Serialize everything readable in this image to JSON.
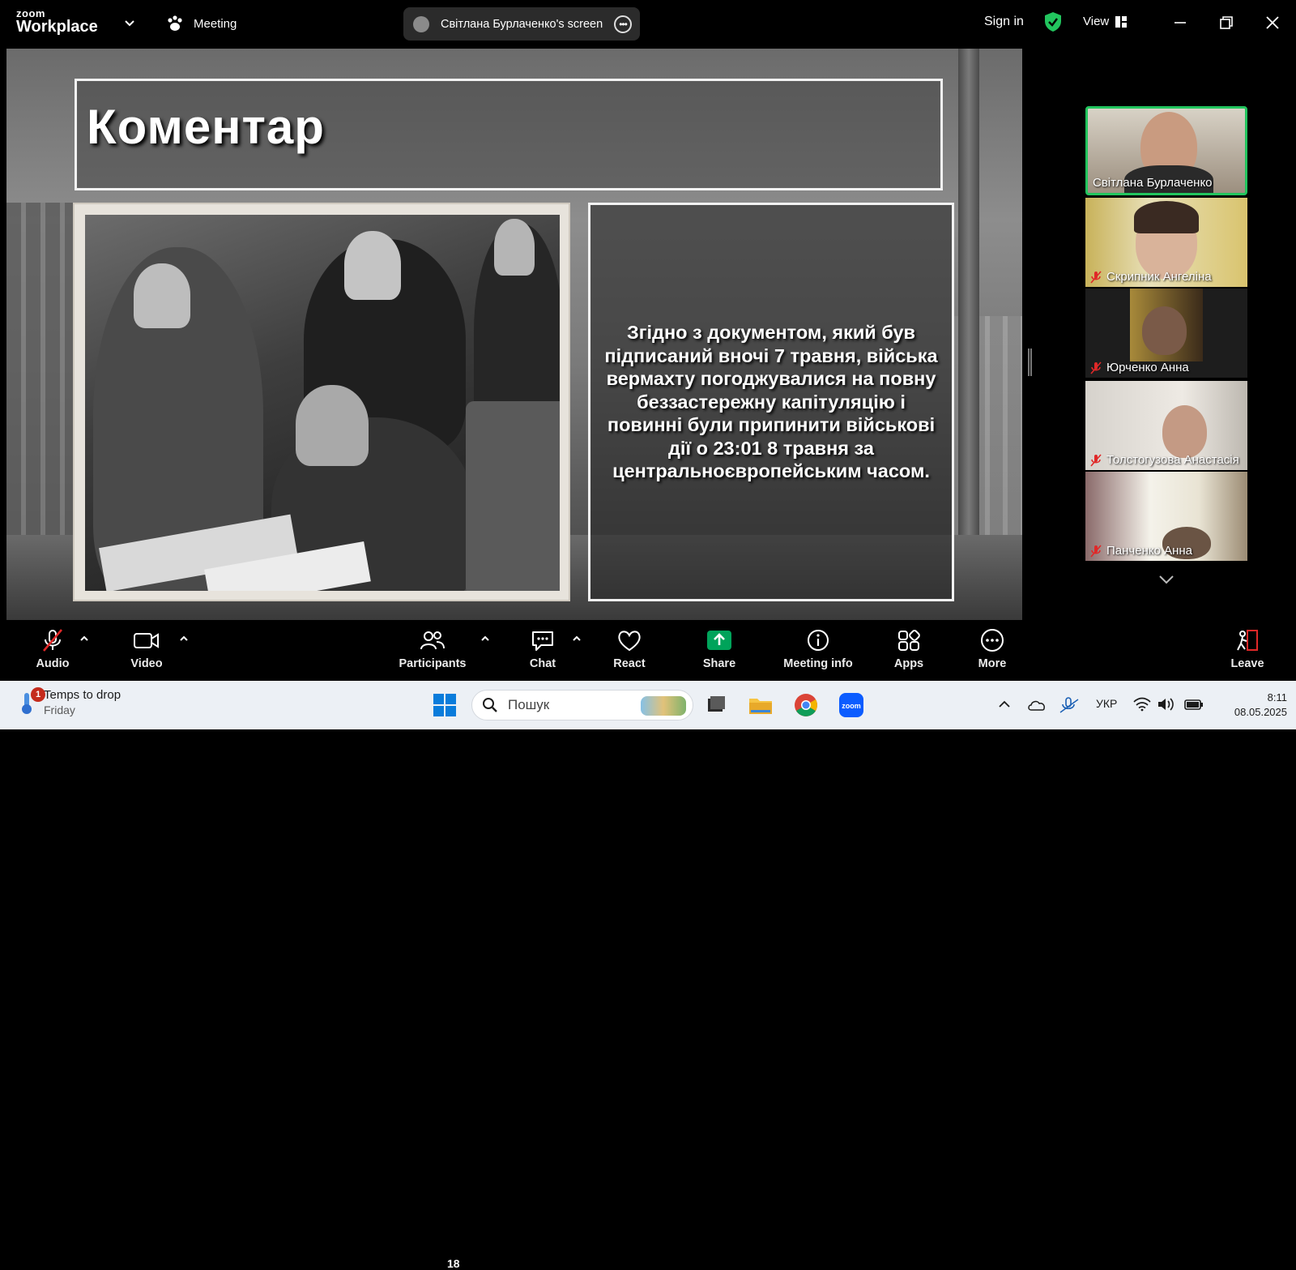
{
  "app": {
    "brand_small": "zoom",
    "brand_big": "Workplace",
    "meeting_label": "Meeting"
  },
  "share_pill": {
    "title": "Світлана Бурлаченко's screen"
  },
  "topbar": {
    "sign_in": "Sign in",
    "view": "View"
  },
  "slide": {
    "title": "Коментар",
    "body": "Згідно з документом, який був підписаний вночі 7 травня, війська вермахту погоджувалися на повну беззастережну капітуляцію і повинні були припинити військові дії о 23:01 8 травня за центральноєвропейським часом."
  },
  "participants_strip": [
    {
      "name": "Світлана Бурлаченко",
      "active": true,
      "muted": false
    },
    {
      "name": "Скрипник Ангеліна",
      "active": false,
      "muted": true
    },
    {
      "name": "Юрченко Анна",
      "active": false,
      "muted": true
    },
    {
      "name": "Толстогузова Анастасія",
      "active": false,
      "muted": true
    },
    {
      "name": "Панченко Анна",
      "active": false,
      "muted": true
    }
  ],
  "toolbar": {
    "audio": "Audio",
    "video": "Video",
    "participants": "Participants",
    "participants_count": "18",
    "chat": "Chat",
    "react": "React",
    "share": "Share",
    "meeting_info": "Meeting info",
    "apps": "Apps",
    "more": "More",
    "leave": "Leave"
  },
  "taskbar": {
    "weather_title": "Temps to drop",
    "weather_sub": "Friday",
    "weather_badge": "1",
    "search_placeholder": "Пошук",
    "language": "УКР",
    "time": "8:11",
    "date": "08.05.2025"
  },
  "colors": {
    "accent_green": "#22c55e",
    "share_green": "#00a35a",
    "leave_red": "#e02828"
  }
}
